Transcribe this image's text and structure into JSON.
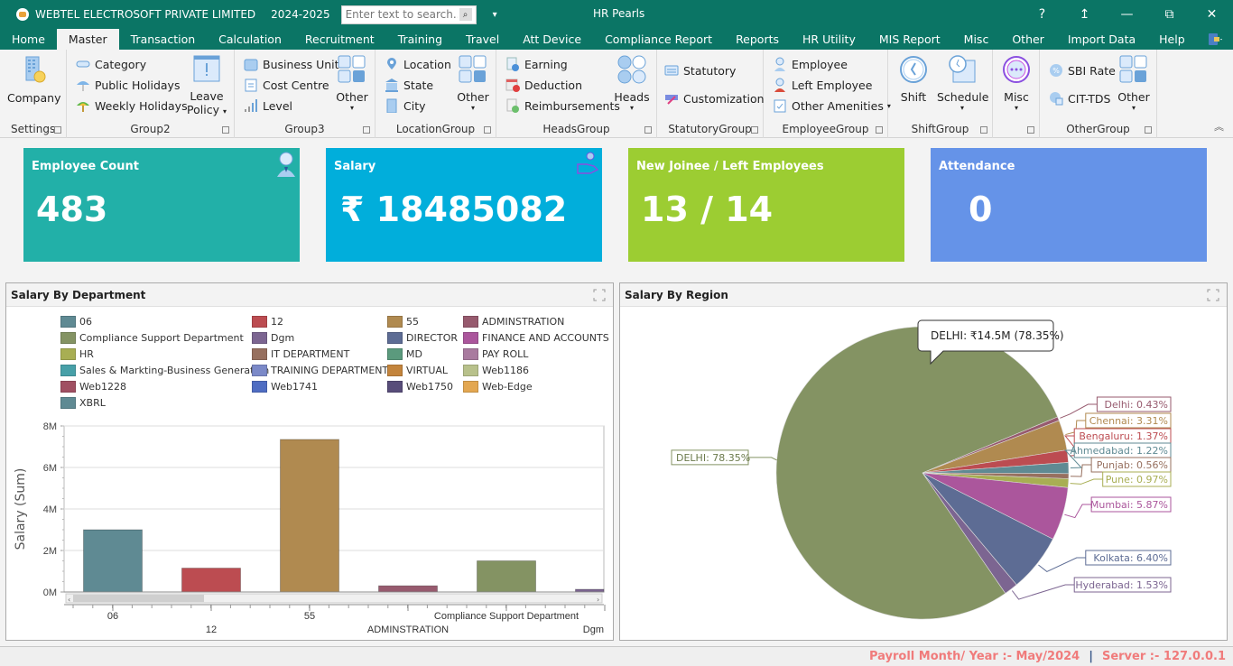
{
  "titlebar": {
    "company": "WEBTEL ELECTROSOFT PRIVATE LIMITED",
    "year": "2024-2025",
    "search_placeholder": "Enter text to search...",
    "app_title": "HR Pearls",
    "help": "?",
    "controls": [
      "help-icon",
      "restore-ribbon-icon",
      "minimize-icon",
      "maximize-icon",
      "close-icon"
    ]
  },
  "menu": {
    "tabs": [
      "Home",
      "Master",
      "Transaction",
      "Calculation",
      "Recruitment",
      "Training",
      "Travel",
      "Att Device",
      "Compliance Report",
      "Reports",
      "HR Utility",
      "MIS Report",
      "Misc",
      "Other",
      "Import Data",
      "Help"
    ],
    "active": "Master"
  },
  "ribbon": {
    "groups": {
      "settings": {
        "title": "Settings",
        "company": "Company"
      },
      "group2": {
        "title": "Group2",
        "category": "Category",
        "public_holidays": "Public Holidays",
        "weekly_holidays": "Weekly Holidays",
        "leave_policy_1": "Leave",
        "leave_policy_2": "Policy"
      },
      "group3": {
        "title": "Group3",
        "business_unit": "Business Unit",
        "cost_centre": "Cost Centre",
        "level": "Level",
        "other": "Other"
      },
      "location": {
        "title": "LocationGroup",
        "location": "Location",
        "state": "State",
        "city": "City",
        "other": "Other"
      },
      "heads": {
        "title": "HeadsGroup",
        "earning": "Earning",
        "deduction": "Deduction",
        "reimbursements": "Reimbursements",
        "heads": "Heads"
      },
      "statutory": {
        "title": "StatutoryGroup",
        "statutory": "Statutory",
        "customization": "Customization"
      },
      "employee": {
        "title": "EmployeeGroup",
        "employee": "Employee",
        "left_employee": "Left Employee",
        "other_amenities": "Other Amenities"
      },
      "shift": {
        "title": "ShiftGroup",
        "shift": "Shift",
        "schedule": "Schedule"
      },
      "misc": {
        "title": "",
        "misc": "Misc"
      },
      "other": {
        "title": "OtherGroup",
        "sbi_rate": "SBI Rate",
        "cit_tds": "CIT-TDS",
        "other": "Other"
      }
    }
  },
  "tiles": [
    {
      "title": "Employee Count",
      "value": "483",
      "color": "#22b0a8",
      "icon": "employee-icon"
    },
    {
      "title": "Salary",
      "value": "₹ 18485082",
      "color": "#01aedb",
      "icon": "salary-hand-icon"
    },
    {
      "title": "New Joinee / Left Employees",
      "value": "13 / 14",
      "color": "#9ccd32",
      "icon": ""
    },
    {
      "title": "Attendance",
      "value": "0",
      "color": "#6593e8",
      "icon": ""
    }
  ],
  "panels": {
    "department": {
      "title": "Salary By Department"
    },
    "region": {
      "title": "Salary By Region",
      "tooltip": "DELHI: ₹14.5M (78.35%)"
    }
  },
  "chart_data": [
    {
      "type": "bar",
      "title": "Salary By Department",
      "xlabel": "",
      "ylabel": "Salary (Sum)",
      "ylim": [
        0,
        8000000
      ],
      "yticks": [
        "0M",
        "2M",
        "4M",
        "6M",
        "8M"
      ],
      "grid": true,
      "legend": [
        {
          "name": "06",
          "color": "#5f8a93"
        },
        {
          "name": "12",
          "color": "#bc4c51"
        },
        {
          "name": "55",
          "color": "#b08a50"
        },
        {
          "name": "ADMINSTRATION",
          "color": "#975a6e"
        },
        {
          "name": "Compliance Support Department",
          "color": "#849363"
        },
        {
          "name": "Dgm",
          "color": "#7c6591"
        },
        {
          "name": "DIRECTOR",
          "color": "#5d6c94"
        },
        {
          "name": "FINANCE AND ACCOUNTS",
          "color": "#ab569c"
        },
        {
          "name": "HR",
          "color": "#a8ae53"
        },
        {
          "name": "IT DEPARTMENT",
          "color": "#97705f"
        },
        {
          "name": "MD",
          "color": "#5b9a7d"
        },
        {
          "name": "PAY ROLL",
          "color": "#a97b9f"
        },
        {
          "name": "Sales & Markting-Business Generation",
          "color": "#47a0a8"
        },
        {
          "name": "TRAINING DEPARTMENT",
          "color": "#7b89c8"
        },
        {
          "name": "VIRTUAL",
          "color": "#c3843c"
        },
        {
          "name": "Web1186",
          "color": "#b8c18b"
        },
        {
          "name": "Web1228",
          "color": "#a04f62"
        },
        {
          "name": "Web1741",
          "color": "#4f6dc2"
        },
        {
          "name": "Web1750",
          "color": "#584d7a"
        },
        {
          "name": "Web-Edge",
          "color": "#e3a751"
        },
        {
          "name": "XBRL",
          "color": "#5f8a93"
        }
      ],
      "categories": [
        "06",
        "12",
        "55",
        "ADMINSTRATION",
        "Compliance Support Department",
        "Dgm"
      ],
      "values": [
        3000000,
        1150000,
        7350000,
        300000,
        1500000,
        130000
      ],
      "colors": [
        "#5f8a93",
        "#bc4c51",
        "#b08a50",
        "#975a6e",
        "#849363",
        "#7c6591"
      ]
    },
    {
      "type": "pie",
      "title": "Salary By Region",
      "slices": [
        {
          "label": "DELHI",
          "percent": 78.35,
          "color": "#849363"
        },
        {
          "label": "Delhi",
          "percent": 0.43,
          "color": "#975a6e"
        },
        {
          "label": "Chennai",
          "percent": 3.31,
          "color": "#b08a50"
        },
        {
          "label": "Bengaluru",
          "percent": 1.37,
          "color": "#bc4c51"
        },
        {
          "label": "Ahmedabad",
          "percent": 1.22,
          "color": "#5f8a93"
        },
        {
          "label": "Punjab",
          "percent": 0.56,
          "color": "#97705f"
        },
        {
          "label": "Pune",
          "percent": 0.97,
          "color": "#a8ae53"
        },
        {
          "label": "Mumbai",
          "percent": 5.87,
          "color": "#ab569c"
        },
        {
          "label": "Kolkata",
          "percent": 6.4,
          "color": "#5d6c94"
        },
        {
          "label": "Hyderabad",
          "percent": 1.53,
          "color": "#7c6591"
        }
      ],
      "labels": [
        "DELHI: 78.35%",
        "Delhi: 0.43%",
        "Chennai: 3.31%",
        "Bengaluru: 1.37%",
        "Ahmedabad: 1.22%",
        "Punjab: 0.56%",
        "Pune: 0.97%",
        "Mumbai: 5.87%",
        "Kolkata: 6.40%",
        "Hyderabad: 1.53%"
      ],
      "tooltip": "DELHI: ₹14.5M (78.35%)"
    }
  ],
  "status": {
    "payroll": "Payroll Month/ Year :- May/2024",
    "separator": "|",
    "server": "Server :- 127.0.0.1"
  }
}
